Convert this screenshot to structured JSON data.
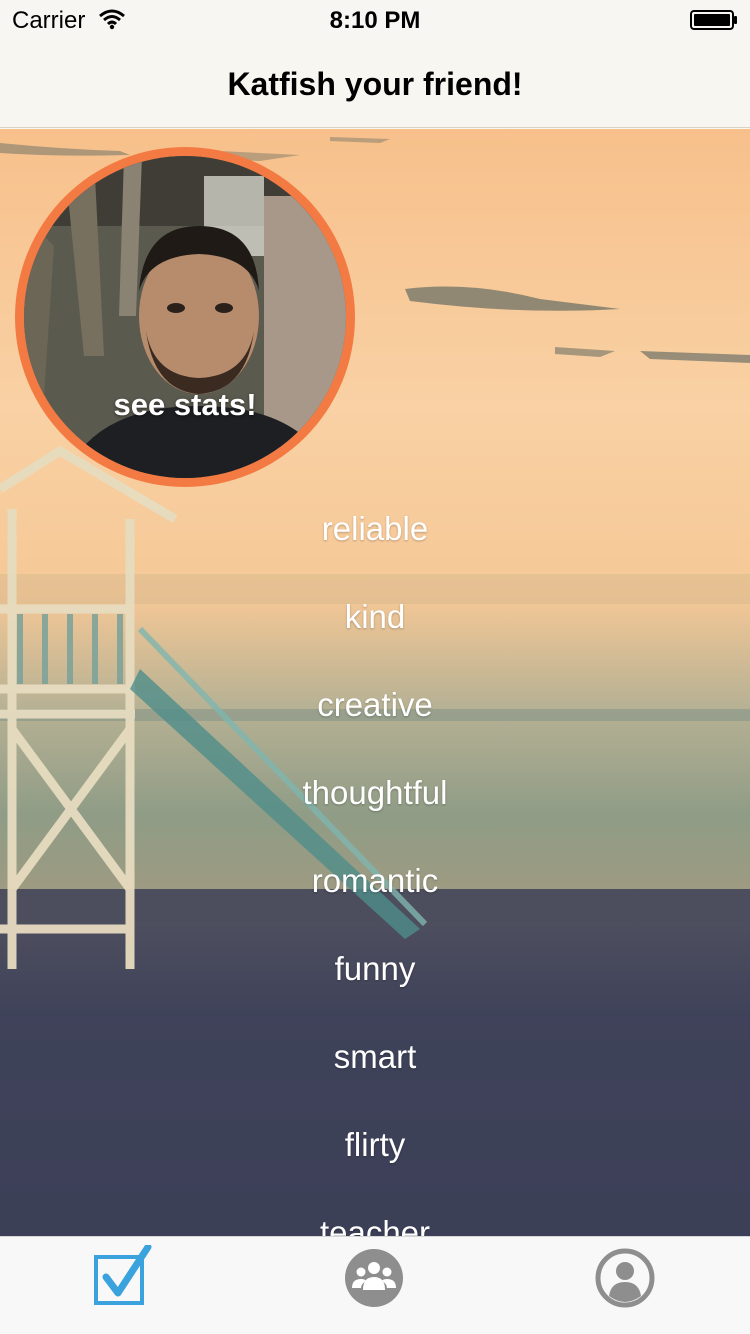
{
  "status": {
    "carrier": "Carrier",
    "time": "8:10 PM"
  },
  "nav": {
    "title": "Katfish your friend!"
  },
  "profile": {
    "stats_label": "see stats!"
  },
  "traits": [
    "reliable",
    "kind",
    "creative",
    "thoughtful",
    "romantic",
    "funny",
    "smart",
    "flirty",
    "teacher"
  ],
  "tabs": [
    {
      "icon": "checkbox-icon",
      "active": true
    },
    {
      "icon": "group-icon",
      "active": false
    },
    {
      "icon": "person-icon",
      "active": false
    }
  ],
  "colors": {
    "accent": "#3aa2dc",
    "ring": "#f47a44",
    "tab_inactive": "#8e8e8e"
  }
}
